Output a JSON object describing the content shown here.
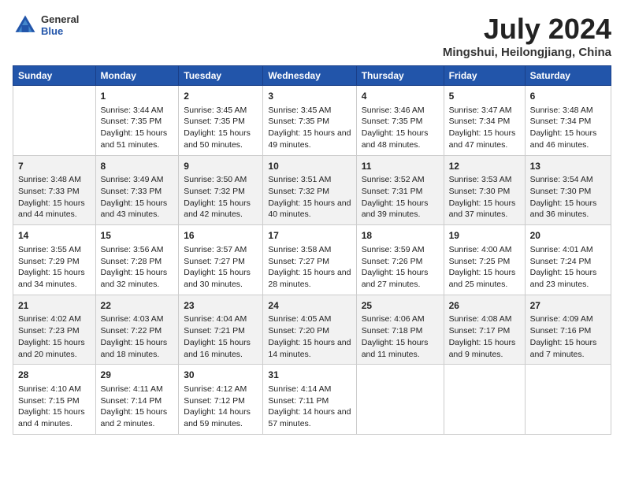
{
  "logo": {
    "general": "General",
    "blue": "Blue"
  },
  "title": {
    "month": "July 2024",
    "location": "Mingshui, Heilongjiang, China"
  },
  "headers": [
    "Sunday",
    "Monday",
    "Tuesday",
    "Wednesday",
    "Thursday",
    "Friday",
    "Saturday"
  ],
  "weeks": [
    [
      {
        "day": "",
        "sunrise": "",
        "sunset": "",
        "daylight": ""
      },
      {
        "day": "1",
        "sunrise": "Sunrise: 3:44 AM",
        "sunset": "Sunset: 7:35 PM",
        "daylight": "Daylight: 15 hours and 51 minutes."
      },
      {
        "day": "2",
        "sunrise": "Sunrise: 3:45 AM",
        "sunset": "Sunset: 7:35 PM",
        "daylight": "Daylight: 15 hours and 50 minutes."
      },
      {
        "day": "3",
        "sunrise": "Sunrise: 3:45 AM",
        "sunset": "Sunset: 7:35 PM",
        "daylight": "Daylight: 15 hours and 49 minutes."
      },
      {
        "day": "4",
        "sunrise": "Sunrise: 3:46 AM",
        "sunset": "Sunset: 7:35 PM",
        "daylight": "Daylight: 15 hours and 48 minutes."
      },
      {
        "day": "5",
        "sunrise": "Sunrise: 3:47 AM",
        "sunset": "Sunset: 7:34 PM",
        "daylight": "Daylight: 15 hours and 47 minutes."
      },
      {
        "day": "6",
        "sunrise": "Sunrise: 3:48 AM",
        "sunset": "Sunset: 7:34 PM",
        "daylight": "Daylight: 15 hours and 46 minutes."
      }
    ],
    [
      {
        "day": "7",
        "sunrise": "Sunrise: 3:48 AM",
        "sunset": "Sunset: 7:33 PM",
        "daylight": "Daylight: 15 hours and 44 minutes."
      },
      {
        "day": "8",
        "sunrise": "Sunrise: 3:49 AM",
        "sunset": "Sunset: 7:33 PM",
        "daylight": "Daylight: 15 hours and 43 minutes."
      },
      {
        "day": "9",
        "sunrise": "Sunrise: 3:50 AM",
        "sunset": "Sunset: 7:32 PM",
        "daylight": "Daylight: 15 hours and 42 minutes."
      },
      {
        "day": "10",
        "sunrise": "Sunrise: 3:51 AM",
        "sunset": "Sunset: 7:32 PM",
        "daylight": "Daylight: 15 hours and 40 minutes."
      },
      {
        "day": "11",
        "sunrise": "Sunrise: 3:52 AM",
        "sunset": "Sunset: 7:31 PM",
        "daylight": "Daylight: 15 hours and 39 minutes."
      },
      {
        "day": "12",
        "sunrise": "Sunrise: 3:53 AM",
        "sunset": "Sunset: 7:30 PM",
        "daylight": "Daylight: 15 hours and 37 minutes."
      },
      {
        "day": "13",
        "sunrise": "Sunrise: 3:54 AM",
        "sunset": "Sunset: 7:30 PM",
        "daylight": "Daylight: 15 hours and 36 minutes."
      }
    ],
    [
      {
        "day": "14",
        "sunrise": "Sunrise: 3:55 AM",
        "sunset": "Sunset: 7:29 PM",
        "daylight": "Daylight: 15 hours and 34 minutes."
      },
      {
        "day": "15",
        "sunrise": "Sunrise: 3:56 AM",
        "sunset": "Sunset: 7:28 PM",
        "daylight": "Daylight: 15 hours and 32 minutes."
      },
      {
        "day": "16",
        "sunrise": "Sunrise: 3:57 AM",
        "sunset": "Sunset: 7:27 PM",
        "daylight": "Daylight: 15 hours and 30 minutes."
      },
      {
        "day": "17",
        "sunrise": "Sunrise: 3:58 AM",
        "sunset": "Sunset: 7:27 PM",
        "daylight": "Daylight: 15 hours and 28 minutes."
      },
      {
        "day": "18",
        "sunrise": "Sunrise: 3:59 AM",
        "sunset": "Sunset: 7:26 PM",
        "daylight": "Daylight: 15 hours and 27 minutes."
      },
      {
        "day": "19",
        "sunrise": "Sunrise: 4:00 AM",
        "sunset": "Sunset: 7:25 PM",
        "daylight": "Daylight: 15 hours and 25 minutes."
      },
      {
        "day": "20",
        "sunrise": "Sunrise: 4:01 AM",
        "sunset": "Sunset: 7:24 PM",
        "daylight": "Daylight: 15 hours and 23 minutes."
      }
    ],
    [
      {
        "day": "21",
        "sunrise": "Sunrise: 4:02 AM",
        "sunset": "Sunset: 7:23 PM",
        "daylight": "Daylight: 15 hours and 20 minutes."
      },
      {
        "day": "22",
        "sunrise": "Sunrise: 4:03 AM",
        "sunset": "Sunset: 7:22 PM",
        "daylight": "Daylight: 15 hours and 18 minutes."
      },
      {
        "day": "23",
        "sunrise": "Sunrise: 4:04 AM",
        "sunset": "Sunset: 7:21 PM",
        "daylight": "Daylight: 15 hours and 16 minutes."
      },
      {
        "day": "24",
        "sunrise": "Sunrise: 4:05 AM",
        "sunset": "Sunset: 7:20 PM",
        "daylight": "Daylight: 15 hours and 14 minutes."
      },
      {
        "day": "25",
        "sunrise": "Sunrise: 4:06 AM",
        "sunset": "Sunset: 7:18 PM",
        "daylight": "Daylight: 15 hours and 11 minutes."
      },
      {
        "day": "26",
        "sunrise": "Sunrise: 4:08 AM",
        "sunset": "Sunset: 7:17 PM",
        "daylight": "Daylight: 15 hours and 9 minutes."
      },
      {
        "day": "27",
        "sunrise": "Sunrise: 4:09 AM",
        "sunset": "Sunset: 7:16 PM",
        "daylight": "Daylight: 15 hours and 7 minutes."
      }
    ],
    [
      {
        "day": "28",
        "sunrise": "Sunrise: 4:10 AM",
        "sunset": "Sunset: 7:15 PM",
        "daylight": "Daylight: 15 hours and 4 minutes."
      },
      {
        "day": "29",
        "sunrise": "Sunrise: 4:11 AM",
        "sunset": "Sunset: 7:14 PM",
        "daylight": "Daylight: 15 hours and 2 minutes."
      },
      {
        "day": "30",
        "sunrise": "Sunrise: 4:12 AM",
        "sunset": "Sunset: 7:12 PM",
        "daylight": "Daylight: 14 hours and 59 minutes."
      },
      {
        "day": "31",
        "sunrise": "Sunrise: 4:14 AM",
        "sunset": "Sunset: 7:11 PM",
        "daylight": "Daylight: 14 hours and 57 minutes."
      },
      {
        "day": "",
        "sunrise": "",
        "sunset": "",
        "daylight": ""
      },
      {
        "day": "",
        "sunrise": "",
        "sunset": "",
        "daylight": ""
      },
      {
        "day": "",
        "sunrise": "",
        "sunset": "",
        "daylight": ""
      }
    ]
  ]
}
